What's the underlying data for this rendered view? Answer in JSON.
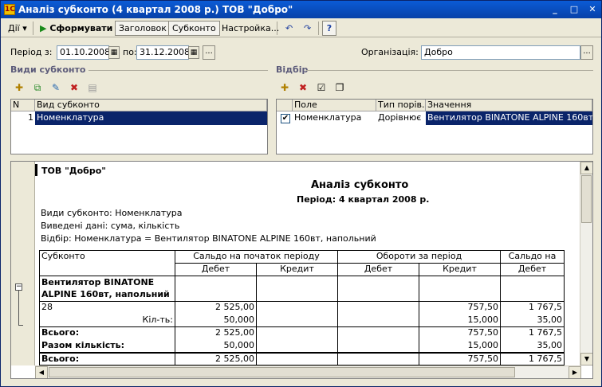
{
  "window": {
    "title": "Аналіз субконто (4 квартал 2008 р.) ТОВ \"Добро\"",
    "icon": "1c-icon",
    "controls": {
      "minimize": "_",
      "maximize": "□",
      "close": "✕"
    }
  },
  "toolbar": {
    "actions": "Дії",
    "generate": "Сформувати",
    "header": "Заголовок",
    "subconto": "Субконто",
    "settings": "Настройка..."
  },
  "filters": {
    "period_label": "Період з:",
    "date_from": "01.10.2008",
    "to_label": "по:",
    "date_to": "31.12.2008",
    "org_label": "Організація:",
    "org_value": "Добро"
  },
  "subconto_types": {
    "title": "Види субконто",
    "columns": [
      "N",
      "Вид субконто"
    ],
    "rows": [
      {
        "n": "1",
        "name": "Номенклатура"
      }
    ]
  },
  "selection": {
    "title": "Відбір",
    "columns": [
      "Поле",
      "Тип порів...",
      "Значення"
    ],
    "rows": [
      {
        "field": "Номенклатура",
        "compare": "Дорівнює",
        "value": "Вентилятор BINATONE ALPINE 160вт, ..."
      }
    ]
  },
  "report": {
    "org": "ТОВ \"Добро\"",
    "title": "Аналіз субконто",
    "period": "Період: 4 квартал 2008 р.",
    "line1": "Види субконто: Номенклатура",
    "line2": "Виведені дані: сума, кількість",
    "line3": "Відбір: Номенклатура = Вентилятор BINATONE ALPINE 160вт, напольний",
    "table": {
      "h_subconto": "Субконто",
      "h_open": "Сальдо на початок періоду",
      "h_turn": "Обороти за період",
      "h_close": "Сальдо на",
      "debit": "Дебет",
      "credit": "Кредит",
      "item_l1": "Вентилятор BINATONE",
      "item_l2": "ALPINE 160вт, напольний",
      "acct": "28",
      "qty_label": "Кіл-ть:",
      "acct_open_debit": "2 525,00",
      "acct_turn_credit": "757,50",
      "acct_close_debit": "1 767,5",
      "qty_open_debit": "50,000",
      "qty_turn_credit": "15,000",
      "qty_close_debit": "35,00",
      "total_label": "Всього:",
      "total_open_debit": "2 525,00",
      "total_turn_credit": "757,50",
      "total_close_debit": "1 767,5",
      "qty_total_label": "Разом кількість:",
      "qty_total_open": "50,000",
      "qty_total_turn": "15,000",
      "qty_total_close": "35,00",
      "grand_label": "Всього:",
      "grand_open": "2 525,00",
      "grand_turn": "757,50",
      "grand_close": "1 767,5"
    }
  }
}
